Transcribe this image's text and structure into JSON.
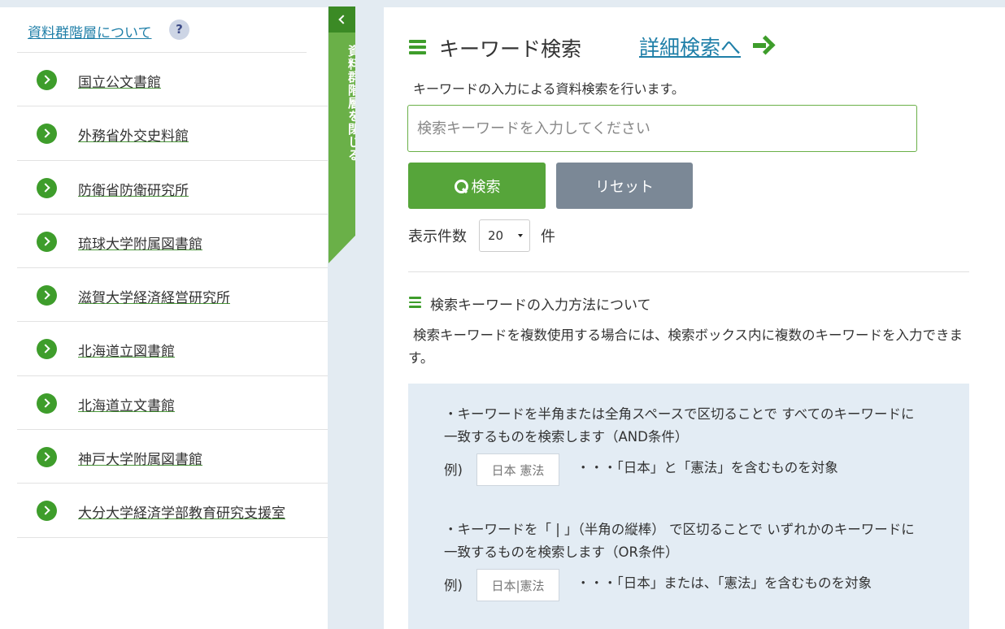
{
  "sidebar": {
    "title": "資料群階層について",
    "help_icon": "?",
    "items": [
      {
        "label": "国立公文書館"
      },
      {
        "label": "外務省外交史料館"
      },
      {
        "label": "防衛省防衛研究所"
      },
      {
        "label": "琉球大学附属図書館"
      },
      {
        "label": "滋賀大学経済経営研究所"
      },
      {
        "label": "北海道立図書館"
      },
      {
        "label": "北海道立文書館"
      },
      {
        "label": "神戸大学附属図書館"
      },
      {
        "label": "大分大学経済学部教育研究支援室"
      }
    ]
  },
  "toggle": {
    "label": "資料群階層を閉じる"
  },
  "main": {
    "title": "キーワード検索",
    "detail_link": "詳細検索へ",
    "description": "キーワードの入力による資料検索を行います。",
    "search_placeholder": "検索キーワードを入力してください",
    "search_value": "",
    "search_button": "検索",
    "reset_button": "リセット",
    "count_label": "表示件数",
    "count_value": "20",
    "count_unit": "件",
    "help_title": "検索キーワードの入力方法について",
    "help_description": "検索キーワードを複数使用する場合には、検索ボックス内に複数のキーワードを入力できます。",
    "rules": [
      {
        "text": "・キーワードを半角または全角スペースで区切ることで すべてのキーワードに一致するものを検索します（AND条件）",
        "example_label": "例)",
        "example_chip": "日本 憲法",
        "example_desc": "・・・「日本」と「憲法」を含むものを対象"
      },
      {
        "text": "・キーワードを「 | 」（半角の縦棒） で区切ることで いずれかのキーワードに一致するものを検索します（OR条件）",
        "example_label": "例)",
        "example_chip": "日本|憲法",
        "example_desc": "・・・「日本」または、「憲法」を含むものを対象"
      }
    ]
  },
  "colors": {
    "accent_green": "#3e9d2b",
    "search_button": "#56a53a",
    "reset_button": "#7b8896",
    "link_blue": "#1f7fa8",
    "page_bg": "#e3ebf2"
  }
}
